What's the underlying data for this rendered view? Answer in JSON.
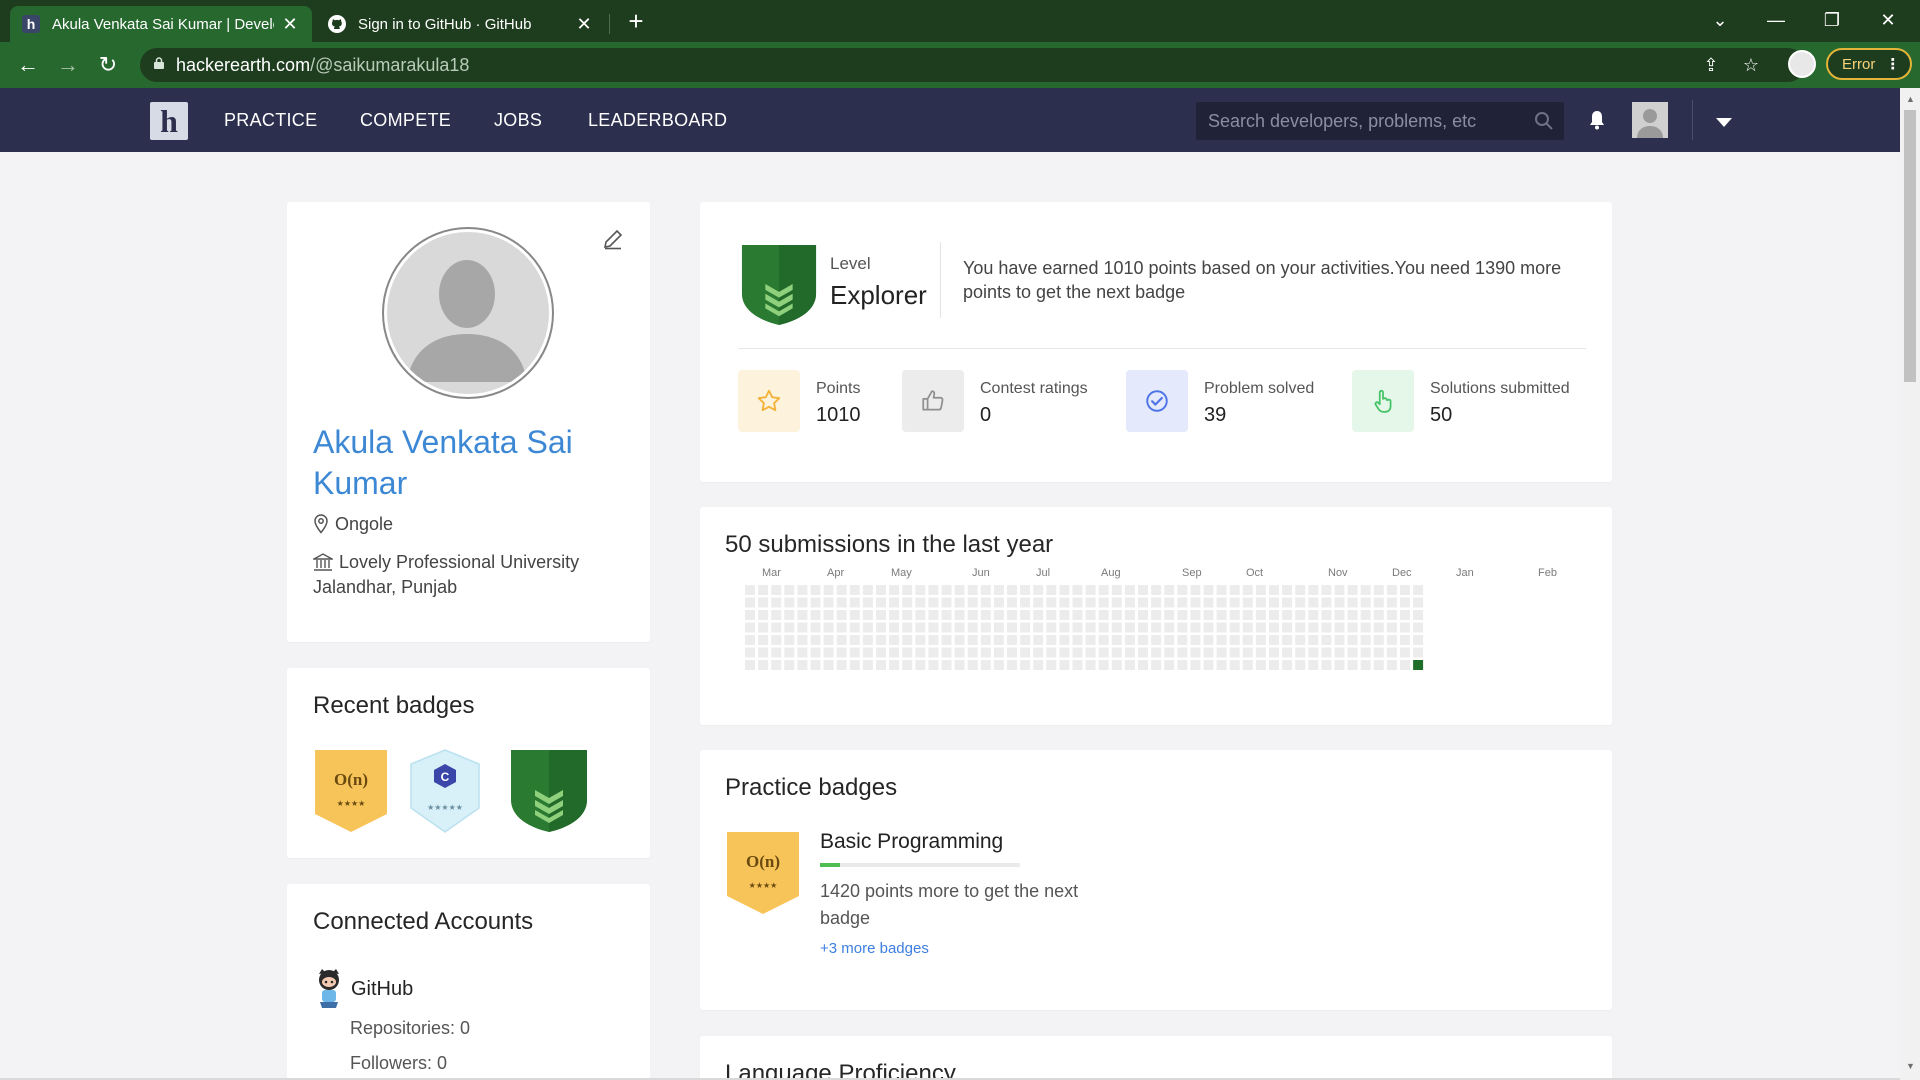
{
  "browser": {
    "tabs": [
      {
        "title": "Akula Venkata Sai Kumar | Develo",
        "favicon": "h",
        "active": true
      },
      {
        "title": "Sign in to GitHub · GitHub",
        "favicon": "github-logo",
        "active": false
      }
    ],
    "url_host": "hackerearth.com",
    "url_path": "/@saikumarakula18",
    "profile_status": "Error"
  },
  "site_header": {
    "logo_letter": "h",
    "nav": [
      "PRACTICE",
      "COMPETE",
      "JOBS",
      "LEADERBOARD"
    ],
    "search_placeholder": "Search developers, problems, etc"
  },
  "profile": {
    "name": "Akula Venkata Sai Kumar",
    "location": "Ongole",
    "university": "Lovely Professional University",
    "university_location": "Jalandhar, Punjab"
  },
  "level": {
    "label": "Level",
    "name": "Explorer",
    "message": "You have earned 1010 points based on your activities.You need 1390 more points to get the next badge"
  },
  "stats": [
    {
      "label": "Points",
      "value": "1010",
      "icon": "star-icon",
      "bg": "#fdf3dc",
      "fg": "#f3b23a"
    },
    {
      "label": "Contest ratings",
      "value": "0",
      "icon": "thumbs-up-icon",
      "bg": "#ececec",
      "fg": "#8f8f8f"
    },
    {
      "label": "Problem solved",
      "value": "39",
      "icon": "check-circle-icon",
      "bg": "#e4eafc",
      "fg": "#4f74e6"
    },
    {
      "label": "Solutions submitted",
      "value": "50",
      "icon": "hand-pointer-icon",
      "bg": "#e4f7e8",
      "fg": "#44c266"
    }
  ],
  "activity": {
    "title": "50 submissions in the last year",
    "months": [
      "Mar",
      "Apr",
      "May",
      "Jun",
      "Jul",
      "Aug",
      "Sep",
      "Oct",
      "Nov",
      "Dec",
      "Jan",
      "Feb"
    ],
    "weeks": 52,
    "days_per_week": 7,
    "cell_color": "#ececec",
    "active_color": "#1f6f2a",
    "active_cells": [
      {
        "week": 51,
        "day": 6
      }
    ]
  },
  "recent_badges": {
    "title": "Recent badges",
    "items": [
      {
        "name": "complexity-badge",
        "text": "O(n)",
        "stars": "★★★★",
        "color": "#f7c45a"
      },
      {
        "name": "c-language-badge",
        "text": "C",
        "stars": "★★★★★",
        "color": "#d8f0f8"
      },
      {
        "name": "explorer-level-badge",
        "text": "",
        "stars": "",
        "color": "#2a7a32"
      }
    ]
  },
  "practice_badges": {
    "title": "Practice badges",
    "badge_text": "O(n)",
    "badge_stars": "★★★★",
    "category": "Basic Programming",
    "progress_fraction": 0.1,
    "message": "1420 points more to get the next badge",
    "more_link": "+3 more badges"
  },
  "connected_accounts": {
    "title": "Connected Accounts",
    "service": "GitHub",
    "repositories": "Repositories: 0",
    "followers": "Followers: 0"
  },
  "language": {
    "title": "Language Proficiency"
  },
  "colors": {
    "brand_header": "#2c2f4d",
    "name_link": "#3d88d4",
    "browser_frame": "#27682f"
  }
}
